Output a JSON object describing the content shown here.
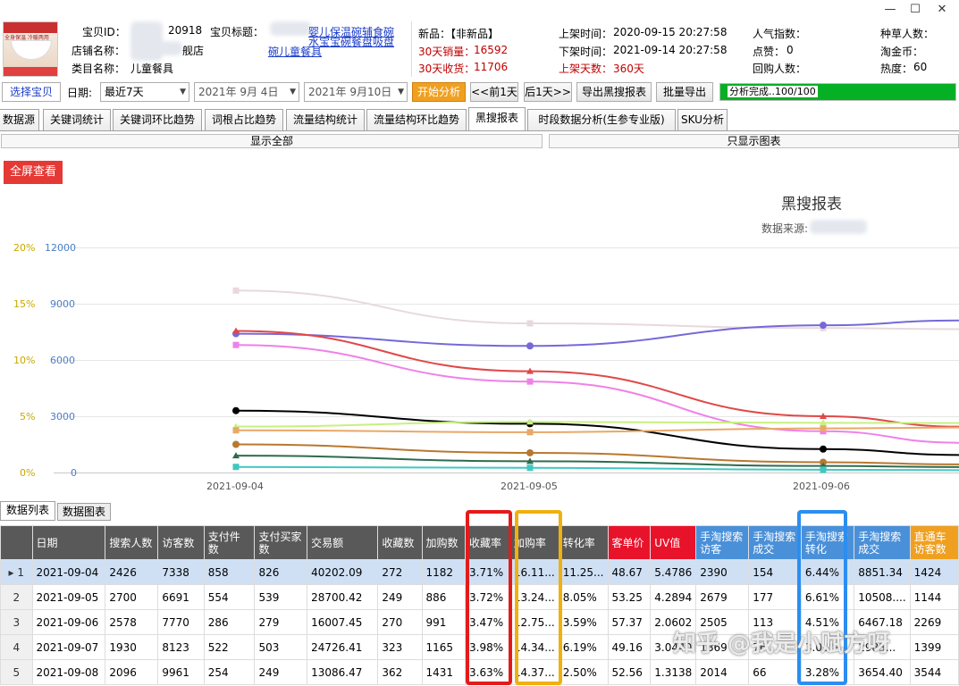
{
  "window": {
    "controls": [
      "—",
      "☐",
      "✕"
    ]
  },
  "product": {
    "id_label": "宝贝ID：",
    "id_value": "20918",
    "title_label": "宝贝标题：",
    "title_value": "婴儿保温碗辅食碗",
    "title_value_line2": "水宝宝碗餐盘吸盘",
    "title_value_line3": "碗儿童餐具",
    "shop_label": "店铺名称：",
    "shop_value": "舰店",
    "category_label": "类目名称：",
    "category_value": "儿童餐具",
    "thumb_text": "全身保温 冷暖两用"
  },
  "stats": {
    "new_label": "新品：【非新品】",
    "sales30_label": "30天销量：",
    "sales30_value": "16592",
    "receive30_label": "30天收货：",
    "receive30_value": "11706",
    "listed_label": "上架时间：",
    "listed_value": "2020-09-15 20:27:58",
    "delisted_label": "下架时间：",
    "delisted_value": "2021-09-14 20:27:58",
    "days_label": "上架天数：",
    "days_value": "360天",
    "popularity_label": "人气指数：",
    "likes_label": "点赞：",
    "likes_value": "0",
    "repurchase_label": "回购人数：",
    "grass_label": "种草人数：",
    "coins_label": "淘金币：",
    "heat_label": "热度：",
    "heat_value": "60"
  },
  "toolbar": {
    "select_item": "选择宝贝",
    "date_label": "日期:",
    "range_value": "最近7天",
    "start_date": "2021年  9月  4日",
    "end_date": "2021年  9月10日",
    "analyze": "开始分析",
    "prev_day": "<<前1天",
    "next_day": "后1天>>",
    "export_report": "导出黑搜报表",
    "batch_export": "批量导出",
    "progress_text": "分析完成..100/100",
    "progress": 1.0
  },
  "tabs": [
    "数据源",
    "关键词统计",
    "关键词环比趋势",
    "词根占比趋势",
    "流量结构统计",
    "流量结构环比趋势",
    "黑搜报表",
    "时段数据分析(生参专业版)",
    "SKU分析"
  ],
  "active_tab": "黑搜报表",
  "view": {
    "show_all": "显示全部",
    "chart_only": "只显示图表",
    "fullscreen": "全屏查看"
  },
  "chart_data": {
    "type": "line",
    "title": "黑搜报表",
    "subtitle": "数据来源:",
    "x": [
      "2021-09-04",
      "2021-09-05",
      "2021-09-06"
    ],
    "y_left_ticks": [
      "0%",
      "5%",
      "10%",
      "15%",
      "20%"
    ],
    "y_right_ticks": [
      "0",
      "3000",
      "6000",
      "9000",
      "12000"
    ],
    "y_right_range": [
      0,
      12000
    ],
    "series": [
      {
        "color": "#e8d8dc",
        "values": [
          9700,
          7950,
          7700
        ]
      },
      {
        "color": "#7569d8",
        "values": [
          7400,
          6750,
          7850
        ]
      },
      {
        "color": "#e04848",
        "values": [
          7550,
          5400,
          3000
        ]
      },
      {
        "color": "#f080e8",
        "values": [
          6800,
          4850,
          2200
        ]
      },
      {
        "color": "#000000",
        "values": [
          3300,
          2600,
          1250
        ]
      },
      {
        "color": "#c8f080",
        "values": [
          2450,
          2700,
          2650
        ]
      },
      {
        "color": "#e8a868",
        "values": [
          2250,
          2150,
          2350
        ]
      },
      {
        "color": "#b87830",
        "values": [
          1500,
          1050,
          550
        ]
      },
      {
        "color": "#2e6b4e",
        "values": [
          900,
          600,
          350
        ]
      },
      {
        "color": "#40c8c0",
        "values": [
          300,
          250,
          150
        ]
      }
    ]
  },
  "bottom_tabs": {
    "list": "数据列表",
    "chart": "数据图表"
  },
  "table": {
    "headers": [
      "日期",
      "搜索人数",
      "访客数",
      "支付件数",
      "支付买家数",
      "交易额",
      "收藏数",
      "加购数",
      "收藏率",
      "加购率",
      "转化率",
      "客单价",
      "UV值",
      "手淘搜索访客",
      "手淘搜索成交",
      "手淘搜索转化",
      "手淘搜索成交",
      "直通车访客数"
    ],
    "rows": [
      [
        "2021-09-04",
        "2426",
        "7338",
        "858",
        "826",
        "40202.09",
        "272",
        "1182",
        "3.71%",
        "16.11...",
        "11.25...",
        "48.67",
        "5.4786",
        "2390",
        "154",
        "6.44%",
        "8851.34",
        "1424"
      ],
      [
        "2021-09-05",
        "2700",
        "6691",
        "554",
        "539",
        "28700.42",
        "249",
        "886",
        "3.72%",
        "13.24...",
        "8.05%",
        "53.25",
        "4.2894",
        "2679",
        "177",
        "6.61%",
        "10508....",
        "1144"
      ],
      [
        "2021-09-06",
        "2578",
        "7770",
        "286",
        "279",
        "16007.45",
        "270",
        "991",
        "3.47%",
        "12.75...",
        "3.59%",
        "57.37",
        "2.0602",
        "2505",
        "113",
        "4.51%",
        "6467.18",
        "2269"
      ],
      [
        "2021-09-07",
        "1930",
        "8123",
        "522",
        "503",
        "24726.41",
        "323",
        "1165",
        "3.98%",
        "14.34...",
        "6.19%",
        "49.16",
        "3.0440",
        "1869",
        "76",
        "3.09%",
        "2983...",
        "1399"
      ],
      [
        "2021-09-08",
        "2096",
        "9961",
        "254",
        "249",
        "13086.47",
        "362",
        "1431",
        "3.63%",
        "14.37...",
        "2.50%",
        "52.56",
        "1.3138",
        "2014",
        "66",
        "3.28%",
        "3654.40",
        "3544"
      ]
    ]
  },
  "header_colors": [
    "#595959",
    "#595959",
    "#595959",
    "#595959",
    "#595959",
    "#595959",
    "#595959",
    "#595959",
    "#595959",
    "#595959",
    "#595959",
    "#e8132b",
    "#e8132b",
    "#4a90d9",
    "#4a90d9",
    "#4a90d9",
    "#4a90d9",
    "#f0a020"
  ],
  "watermark": "知乎 @我是小赋方呀"
}
